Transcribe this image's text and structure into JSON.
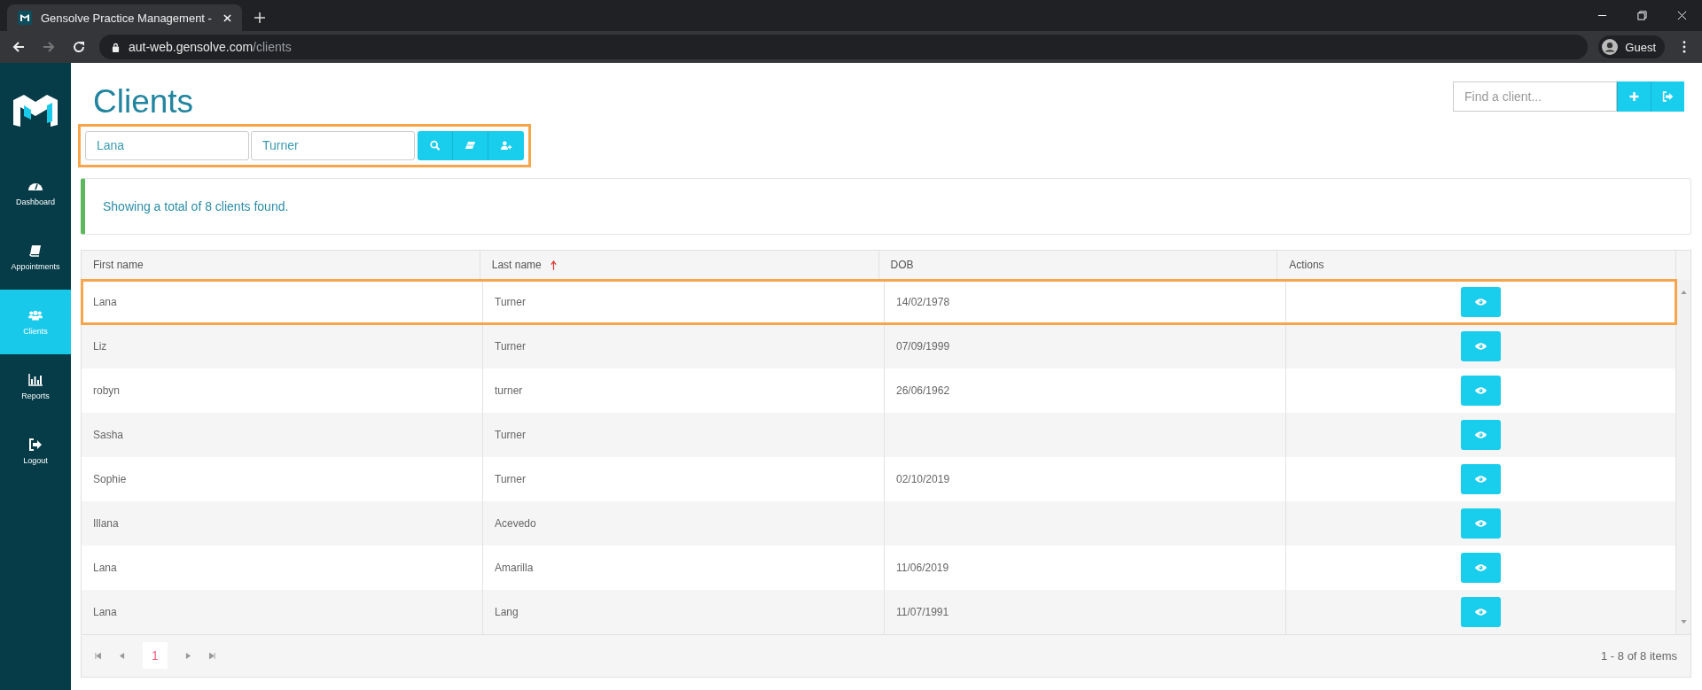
{
  "browser": {
    "tab_title": "Gensolve Practice Management -",
    "url_host": "aut-web.gensolve.com",
    "url_path": "/clients",
    "profile": "Guest"
  },
  "sidebar": {
    "items": [
      {
        "label": "Dashboard",
        "kind": "gauge",
        "selected": false
      },
      {
        "label": "Appointments",
        "kind": "book",
        "selected": false
      },
      {
        "label": "Clients",
        "kind": "users",
        "selected": true
      },
      {
        "label": "Reports",
        "kind": "chart",
        "selected": false
      },
      {
        "label": "Logout",
        "kind": "logout",
        "selected": false
      }
    ]
  },
  "page_title": "Clients",
  "quick_search": {
    "placeholder": "Find a client..."
  },
  "search_form": {
    "annotated": true,
    "first_name": "Lana",
    "last_name": "Turner"
  },
  "alert": "Showing a total of 8 clients found.",
  "table": {
    "columns": [
      {
        "label": "First name",
        "sorted": false
      },
      {
        "label": "Last name",
        "sorted": true
      },
      {
        "label": "DOB",
        "sorted": false
      },
      {
        "label": "Actions",
        "sorted": false
      }
    ],
    "rows": [
      {
        "first_name": "Lana",
        "last_name": "Turner",
        "dob": "14/02/1978",
        "annotated": true
      },
      {
        "first_name": "Liz",
        "last_name": "Turner",
        "dob": "07/09/1999",
        "annotated": false
      },
      {
        "first_name": "robyn",
        "last_name": "turner",
        "dob": "26/06/1962",
        "annotated": false
      },
      {
        "first_name": "Sasha",
        "last_name": "Turner",
        "annotated": false
      },
      {
        "first_name": "Sophie",
        "last_name": "Turner",
        "dob": "02/10/2019",
        "annotated": false
      },
      {
        "first_name": "Illana",
        "last_name": "Acevedo",
        "annotated": false
      },
      {
        "first_name": "Lana",
        "last_name": "Amarilla",
        "dob": "11/06/2019",
        "annotated": false
      },
      {
        "first_name": "Lana",
        "last_name": "Lang",
        "dob": "11/07/1991",
        "annotated": false
      }
    ]
  },
  "pagination": {
    "current_page": "1",
    "summary": "1 - 8 of 8 items"
  }
}
